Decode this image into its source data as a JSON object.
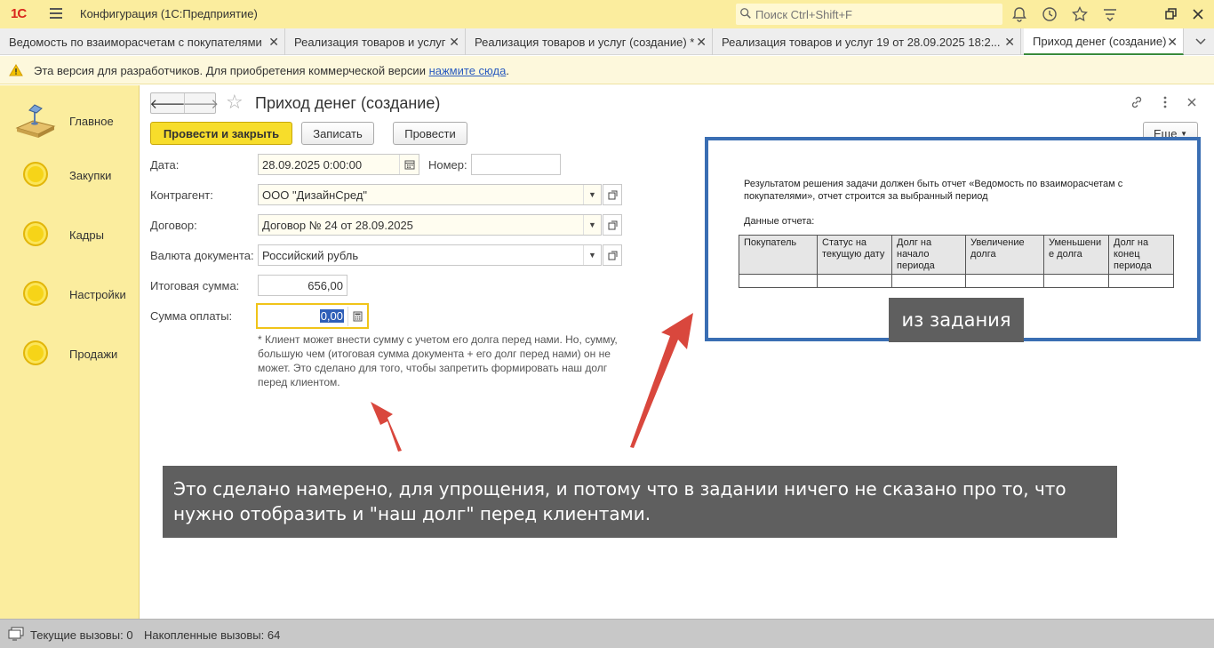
{
  "app": {
    "logo": "1С",
    "title": "Конфигурация  (1С:Предприятие)",
    "search_placeholder": "Поиск Ctrl+Shift+F"
  },
  "top_icons": [
    "bell-icon",
    "history-icon",
    "star-icon",
    "settings-icon",
    "restore-window-icon",
    "close-icon"
  ],
  "tabs": [
    {
      "label": "Ведомость по взаиморасчетам с покупателями"
    },
    {
      "label": "Реализация товаров и услуг"
    },
    {
      "label": "Реализация товаров и услуг (создание) *"
    },
    {
      "label": "Реализация товаров и услуг 19 от 28.09.2025 18:2..."
    },
    {
      "label": "Приход денег (создание)"
    }
  ],
  "warning": {
    "text": "Эта версия для разработчиков. Для приобретения коммерческой версии ",
    "link": "нажмите сюда",
    "suffix": "."
  },
  "sidebar": {
    "items": [
      {
        "label": "Главное"
      },
      {
        "label": "Закупки"
      },
      {
        "label": "Кадры"
      },
      {
        "label": "Настройки"
      },
      {
        "label": "Продажи"
      }
    ]
  },
  "form": {
    "title": "Приход денег (создание)",
    "buttons": {
      "post_close": "Провести и закрыть",
      "save": "Записать",
      "post": "Провести",
      "more": "Еще"
    },
    "fields": {
      "date_label": "Дата:",
      "date_value": "28.09.2025  0:00:00",
      "number_label": "Номер:",
      "number_value": "",
      "counterparty_label": "Контрагент:",
      "counterparty_value": "ООО \"ДизайнСред\"",
      "contract_label": "Договор:",
      "contract_value": "Договор № 24 от 28.09.2025",
      "currency_label": "Валюта документа:",
      "currency_value": "Российский рубль",
      "total_label": "Итоговая сумма:",
      "total_value": "656,00",
      "payment_label": "Сумма оплаты:",
      "payment_value": "0,00"
    },
    "note": "* Клиент может внести сумму с учетом его долга перед нами. Но, сумму, большую чем (итоговая сумма документа + его долг перед нами) он не может. Это сделано для того, чтобы запретить формировать наш долг перед клиентом."
  },
  "task_doc": {
    "text": "Результатом решения задачи должен быть отчет «Ведомость по взаиморасчетам с покупателями», отчет строится за выбранный период",
    "subtitle": "Данные отчета:",
    "columns": [
      "Покупатель",
      "Статус на текущую дату",
      "Долг на начало периода",
      "Увеличение долга",
      "Уменьшени е долга",
      "Долг на конец периода"
    ],
    "caption": "из задания"
  },
  "annotation": {
    "text": "Это сделано намерено, для упрощения, и потому что в задании ничего не сказано про то, что нужно отобразить и \"наш долг\" перед клиентами."
  },
  "status": {
    "current_calls": "Текущие вызовы: 0",
    "accumulated_calls": "Накопленные вызовы: 64"
  },
  "colors": {
    "accent_yellow": "#f7dd2b",
    "sidebar_bg": "#fbed9e",
    "annotation_arrow": "#d9473d",
    "doc_border": "#3a6eb3",
    "caption_bg": "#5f5f5f"
  }
}
